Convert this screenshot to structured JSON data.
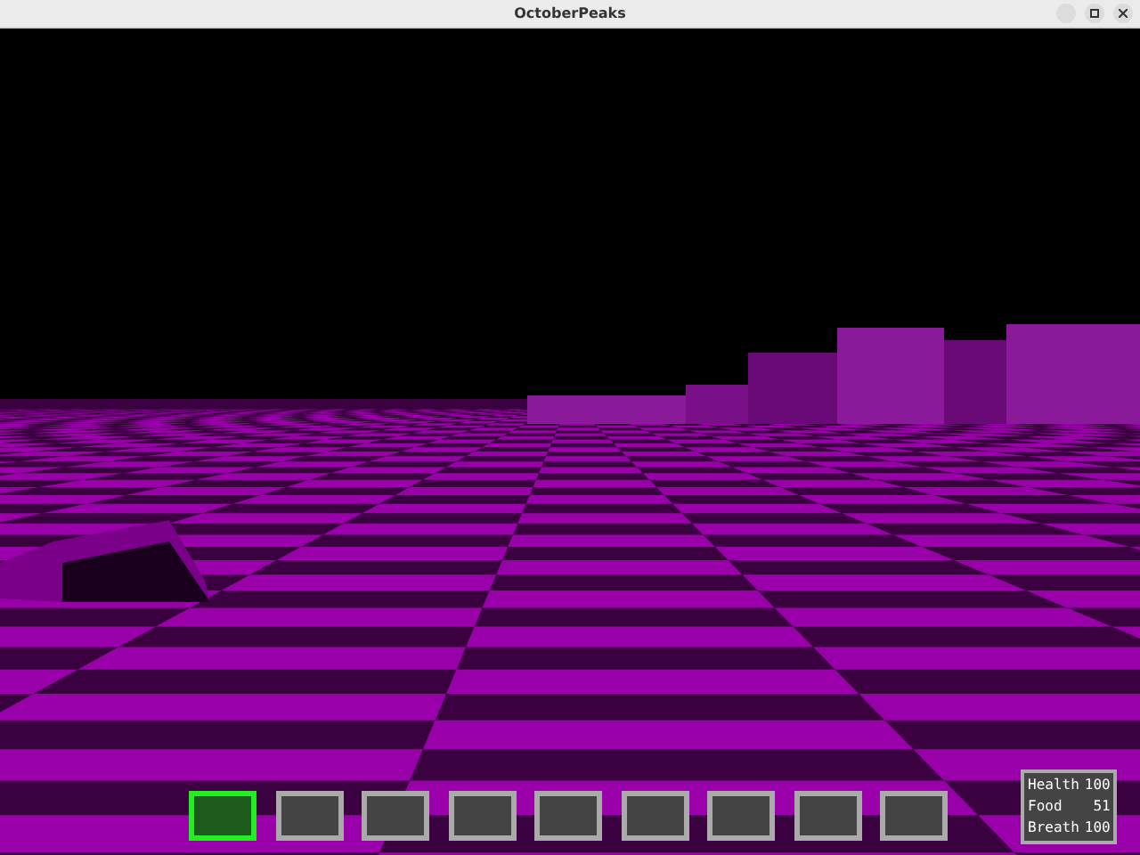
{
  "window": {
    "title": "OctoberPeaks"
  },
  "hotbar": {
    "slots": [
      {
        "selected": true
      },
      {
        "selected": false
      },
      {
        "selected": false
      },
      {
        "selected": false
      },
      {
        "selected": false
      },
      {
        "selected": false
      },
      {
        "selected": false
      },
      {
        "selected": false
      },
      {
        "selected": false
      }
    ]
  },
  "stats": [
    {
      "label": "Health",
      "value": "100"
    },
    {
      "label": "Food",
      "value": "51"
    },
    {
      "label": "Breath",
      "value": "100"
    }
  ]
}
